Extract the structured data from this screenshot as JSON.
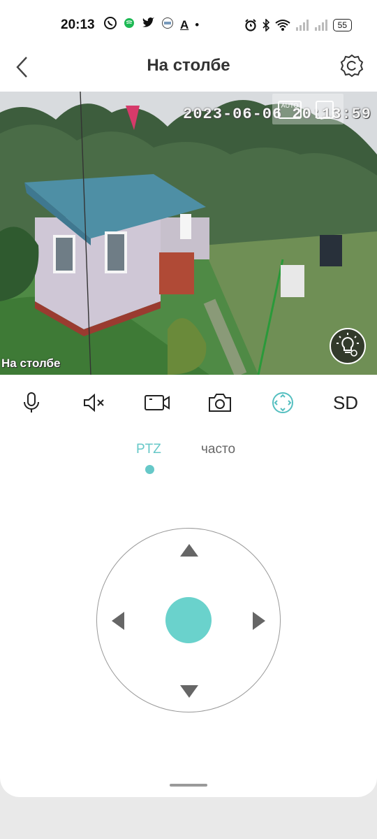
{
  "status_bar": {
    "time": "20:13",
    "battery": "55",
    "left_icons": [
      "viber-icon",
      "spotify-icon",
      "twitter-icon",
      "app-icon",
      "font-icon",
      "dot-icon"
    ],
    "right_icons": [
      "alarm-icon",
      "bluetooth-icon",
      "wifi-icon",
      "signal-icon",
      "signal-icon",
      "battery-icon"
    ]
  },
  "header": {
    "title": "На столбе"
  },
  "video": {
    "timestamp": "2023-06-06 20:13:59",
    "camera_label": "На столбе",
    "auto_label": "AUTO"
  },
  "controls": {
    "items": [
      "microphone-icon",
      "mute-icon",
      "record-icon",
      "snapshot-icon",
      "ptz-icon"
    ],
    "sd_label": "SD"
  },
  "tabs": {
    "ptz": "PTZ",
    "often": "часто"
  },
  "colors": {
    "accent": "#66c8c8",
    "joystick_center": "#6ad2cc"
  }
}
